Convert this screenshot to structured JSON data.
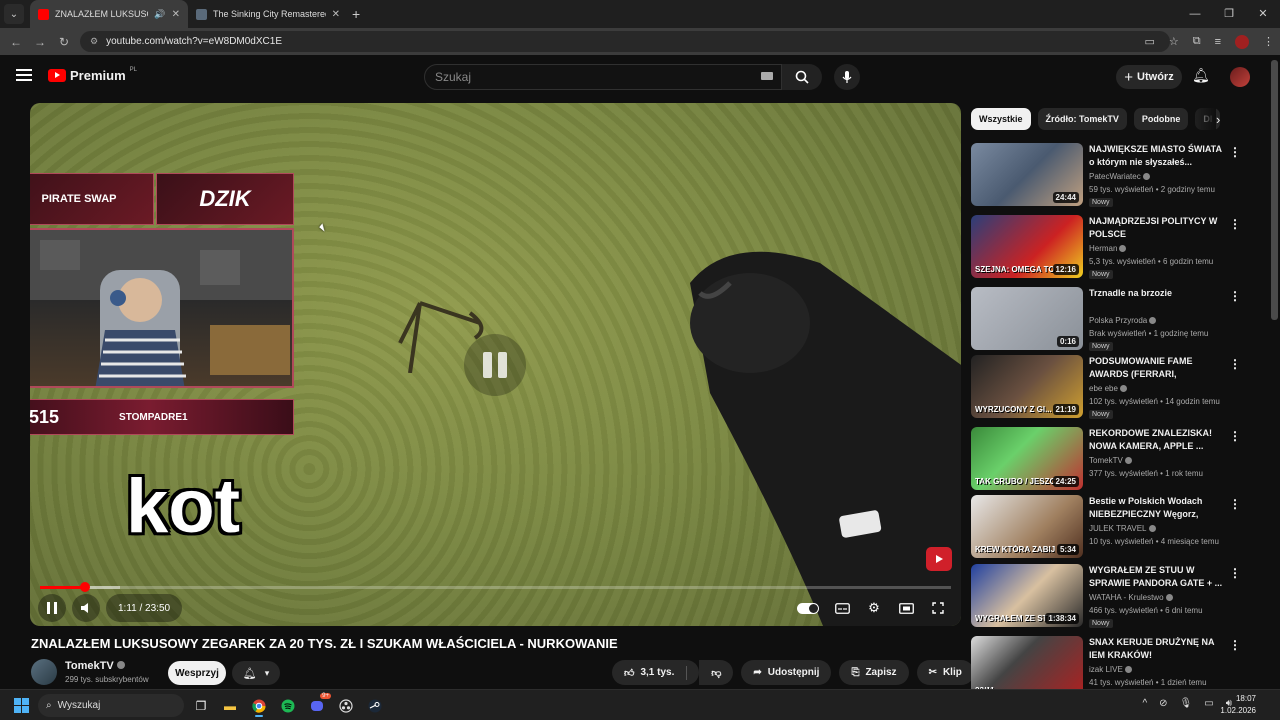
{
  "browser": {
    "tabs": [
      {
        "title": "ZNALAZŁEM LUKSUSOWY",
        "audio_icon": "speaker-icon",
        "active": true
      },
      {
        "title": "The Sinking City Remastered -",
        "active": false
      }
    ],
    "url": "youtube.com/watch?v=eW8DM0dXC1E"
  },
  "youtube": {
    "logo_text": "Premium",
    "region": "PL",
    "search_placeholder": "Szukaj",
    "create_label": "Utwórz"
  },
  "player": {
    "subtitle_word": "kot",
    "time": "1:11 / 23:50",
    "progress_fraction": 0.0496,
    "overlay": {
      "sponsor_left": "PIRATE SWAP",
      "sponsor_right": "DZIK",
      "counter": "515",
      "handle": "STOMPADRE1"
    }
  },
  "video": {
    "title": "ZNALAZŁEM LUKSUSOWY ZEGAREK ZA 20 TYS. ZŁ I SZUKAM WŁAŚCICIELA - NURKOWANIE",
    "channel": "TomekTV",
    "subs": "299 tys. subskrybentów",
    "support_label": "Wesprzyj",
    "likes": "3,1 tys.",
    "share_label": "Udostępnij",
    "save_label": "Zapisz",
    "clip_label": "Klip"
  },
  "sidebar": {
    "chips": [
      "Wszystkie",
      "Źródło: TomekTV",
      "Podobne",
      "Dl"
    ],
    "recs": [
      {
        "title": "NAJWIĘKSZE MIASTO ŚWIATA o którym nie słyszałeś...",
        "channel": "PatecWariatec",
        "meta": "59 tys. wyświetleń • 2 godziny temu",
        "duration": "24:44",
        "new": "Nowy"
      },
      {
        "title": "NAJMĄDRZEJSI POLITYCY W POLSCE",
        "channel": "Herman",
        "meta": "5,3 tys. wyświetleń • 6 godzin temu",
        "duration": "12:16",
        "new": "Nowy"
      },
      {
        "title": "Trznadle na brzozie",
        "channel": "Polska Przyroda",
        "meta": "Brak wyświetleń • 1 godzinę temu",
        "duration": "0:16",
        "new": "Nowy"
      },
      {
        "title": "PODSUMOWANIE FAME AWARDS (FERRARI, NAJMAN,...",
        "channel": "ebe ebe",
        "meta": "102 tys. wyświetleń • 14 godzin temu",
        "duration": "21:19",
        "new": "Nowy"
      },
      {
        "title": "REKORDOWE ZNALEZISKA! NOWA KAMERA, APPLE ...",
        "channel": "TomekTV",
        "meta": "377 tys. wyświetleń • 1 rok temu",
        "duration": "24:25",
        "new": ""
      },
      {
        "title": "Bestie w Polskich Wodach NIEBEZPIECZNY Węgorz, Sum...",
        "channel": "JULEK TRAVEL",
        "meta": "10 tys. wyświetleń • 4 miesiące temu",
        "duration": "5:34",
        "new": ""
      },
      {
        "title": "WYGRAŁEM ZE STUU W SPRAWIE PANDORA GATE + ...",
        "channel": "WATAHA - Krulestwo",
        "meta": "466 tys. wyświetleń • 6 dni temu",
        "duration": "1:38:34",
        "new": "Nowy"
      },
      {
        "title": "SNAX KERUJE DRUŻYNĘ NA IEM KRAKÓW!",
        "channel": "izak LIVE",
        "meta": "41 tys. wyświetleń • 1 dzień temu",
        "duration": "",
        "new": ""
      }
    ],
    "thumb_texts": [
      "",
      "SZEJNA: OMEGA TO NIE JE...",
      "",
      "WYRZUCONY Z GI...",
      "TAK GRUBO / JESZCZE NIE BY...",
      "KREW KTÓRA ZABIJA",
      "WYGRAŁEM ZE STUU W SĄDZIE",
      "23/11"
    ]
  },
  "taskbar": {
    "search_label": "Wyszukaj",
    "time": "18:07",
    "date": "1.02.2026",
    "discord_badge": "9+"
  },
  "colors": {
    "brand": "#ff0000",
    "bg": "#0f0f0f",
    "accent": "#4fb3f6"
  }
}
